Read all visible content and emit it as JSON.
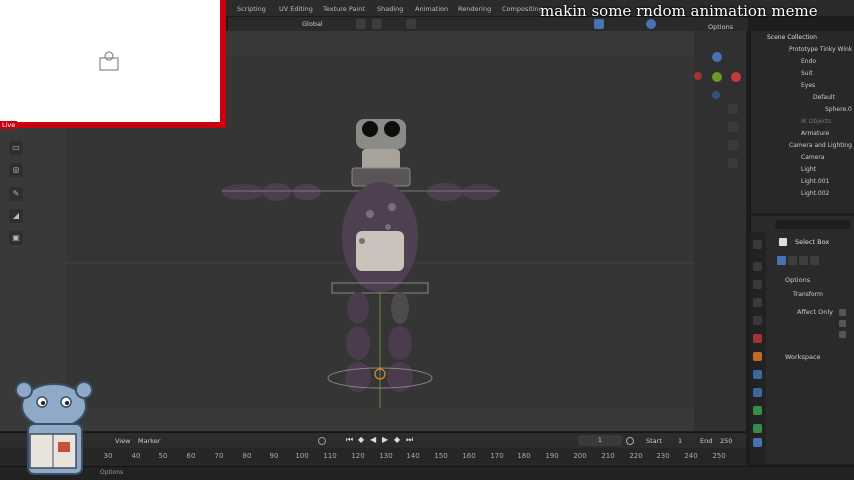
{
  "overlay": {
    "title": "makin some rndom animation meme",
    "live_label": "Live"
  },
  "workspace_tabs": [
    "Scripting",
    "UV Editing",
    "Texture Paint",
    "Shading",
    "Animation",
    "Rendering",
    "Compositing"
  ],
  "header": {
    "orientation": "Global",
    "options_label": "Options"
  },
  "outliner": {
    "title": "Scene Collection",
    "items": [
      {
        "label": "Prototype Tinky Wink",
        "indent": 1,
        "color": "#ccc"
      },
      {
        "label": "Endo",
        "indent": 2,
        "color": "#ccc"
      },
      {
        "label": "Suit",
        "indent": 2,
        "color": "#ccc"
      },
      {
        "label": "Eyes",
        "indent": 2,
        "color": "#ccc"
      },
      {
        "label": "Default",
        "indent": 3,
        "color": "#ccc"
      },
      {
        "label": "Sphere.0",
        "indent": 4,
        "color": "#ccc"
      },
      {
        "label": "IK Objects",
        "indent": 2,
        "color": "#777"
      },
      {
        "label": "Armature",
        "indent": 2,
        "color": "#ccc"
      },
      {
        "label": "Camera and Lighting",
        "indent": 1,
        "color": "#ccc"
      },
      {
        "label": "Camera",
        "indent": 2,
        "color": "#ccc"
      },
      {
        "label": "Light",
        "indent": 2,
        "color": "#ccc"
      },
      {
        "label": "Light.001",
        "indent": 2,
        "color": "#ccc"
      },
      {
        "label": "Light.002",
        "indent": 2,
        "color": "#ccc"
      }
    ]
  },
  "properties": {
    "tool_name": "Select Box",
    "options_label": "Options",
    "transform_label": "Transform",
    "affect_only_label": "Affect Only",
    "workspace_label": "Workspace"
  },
  "timeline": {
    "view_label": "View",
    "marker_label": "Marker",
    "current_frame": "1",
    "start_label": "Start",
    "start_value": "1",
    "end_label": "End",
    "end_value": "250",
    "ticks": [
      "30",
      "40",
      "50",
      "60",
      "70",
      "80",
      "90",
      "100",
      "110",
      "120",
      "130",
      "140",
      "150",
      "160",
      "170",
      "180",
      "190",
      "200",
      "210",
      "220",
      "230",
      "240",
      "250"
    ]
  },
  "status": {
    "options_label": "Options"
  },
  "colors": {
    "accent": "#c8000f",
    "selection": "#4772b3"
  }
}
